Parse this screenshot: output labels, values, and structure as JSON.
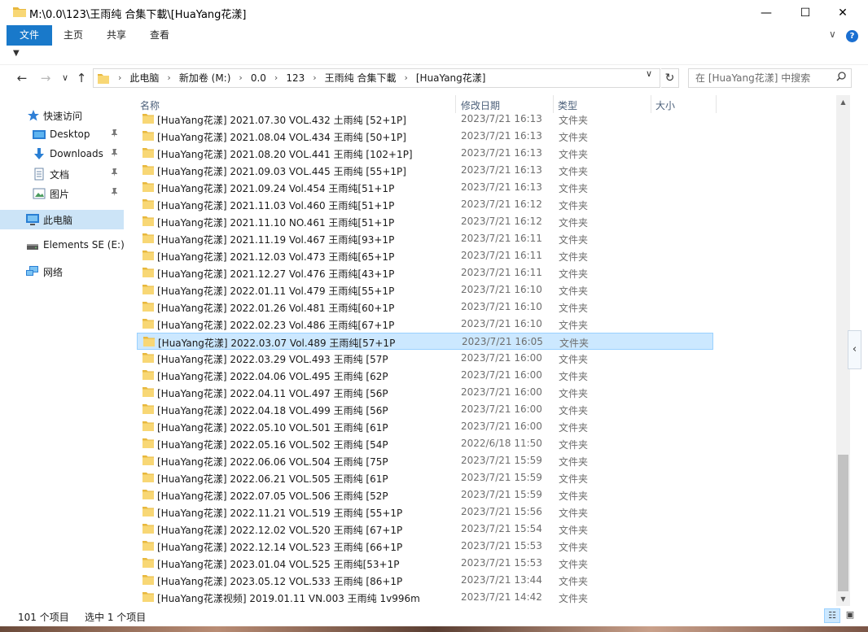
{
  "window": {
    "title": "M:\\0.0\\123\\王雨纯 合集下載\\[HuaYang花漾]",
    "minimize_glyph": "—",
    "maximize_glyph": "☐",
    "close_glyph": "✕"
  },
  "ribbon": {
    "tabs": [
      "文件",
      "主页",
      "共享",
      "查看"
    ],
    "expand_glyph": "∨",
    "help_glyph": "?"
  },
  "qat": {
    "glyph": "▼"
  },
  "nav": {
    "back_glyph": "←",
    "forward_glyph": "→",
    "history_glyph": "∨",
    "up_glyph": "↑",
    "refresh_glyph": "↻",
    "breadcrumb": [
      "此电脑",
      "新加卷 (M:)",
      "0.0",
      "123",
      "王雨纯 合集下載",
      "[HuaYang花漾]"
    ],
    "sep_glyph": "›",
    "dropdown_glyph": "∨"
  },
  "search": {
    "placeholder": "在 [HuaYang花漾] 中搜索"
  },
  "sidebar": {
    "quick_access": "快速访问",
    "items": [
      {
        "label": "Desktop",
        "icon": "desktop-icon",
        "pinned": true
      },
      {
        "label": "Downloads",
        "icon": "downloads-icon",
        "pinned": true
      },
      {
        "label": "文档",
        "icon": "documents-icon",
        "pinned": true
      },
      {
        "label": "图片",
        "icon": "pictures-icon",
        "pinned": true
      }
    ],
    "this_pc": "此电脑",
    "drive": "Elements SE (E:)",
    "network": "网络",
    "pin_glyph": "📌"
  },
  "columns": {
    "name": "名称",
    "date": "修改日期",
    "type": "类型",
    "size": "大小",
    "sort_glyph": "^"
  },
  "files": [
    {
      "name": "[HuaYang花漾] 2021.07.30 VOL.432 土雨纯 [52+1P]",
      "date": "2023/7/21 16:13",
      "type": "文件夹"
    },
    {
      "name": "[HuaYang花漾] 2021.08.04 VOL.434 王雨纯 [50+1P]",
      "date": "2023/7/21 16:13",
      "type": "文件夹"
    },
    {
      "name": "[HuaYang花漾] 2021.08.20 VOL.441 王雨纯 [102+1P]",
      "date": "2023/7/21 16:13",
      "type": "文件夹"
    },
    {
      "name": "[HuaYang花漾] 2021.09.03 VOL.445 王雨纯 [55+1P]",
      "date": "2023/7/21 16:13",
      "type": "文件夹"
    },
    {
      "name": "[HuaYang花漾] 2021.09.24 Vol.454 王雨纯[51+1P",
      "date": "2023/7/21 16:13",
      "type": "文件夹"
    },
    {
      "name": "[HuaYang花漾] 2021.11.03 Vol.460 王雨纯[51+1P",
      "date": "2023/7/21 16:12",
      "type": "文件夹"
    },
    {
      "name": "[HuaYang花漾] 2021.11.10 NO.461 王雨纯[51+1P",
      "date": "2023/7/21 16:12",
      "type": "文件夹"
    },
    {
      "name": "[HuaYang花漾] 2021.11.19 Vol.467 王雨纯[93+1P",
      "date": "2023/7/21 16:11",
      "type": "文件夹"
    },
    {
      "name": "[HuaYang花漾] 2021.12.03 Vol.473 王雨纯[65+1P",
      "date": "2023/7/21 16:11",
      "type": "文件夹"
    },
    {
      "name": "[HuaYang花漾] 2021.12.27 Vol.476 王雨纯[43+1P",
      "date": "2023/7/21 16:11",
      "type": "文件夹"
    },
    {
      "name": "[HuaYang花漾] 2022.01.11 Vol.479 王雨纯[55+1P",
      "date": "2023/7/21 16:10",
      "type": "文件夹"
    },
    {
      "name": "[HuaYang花漾] 2022.01.26 Vol.481 王雨纯[60+1P",
      "date": "2023/7/21 16:10",
      "type": "文件夹"
    },
    {
      "name": "[HuaYang花漾] 2022.02.23 Vol.486 王雨纯[67+1P",
      "date": "2023/7/21 16:10",
      "type": "文件夹"
    },
    {
      "name": "[HuaYang花漾] 2022.03.07 Vol.489 王雨纯[57+1P",
      "date": "2023/7/21 16:05",
      "type": "文件夹",
      "selected": true
    },
    {
      "name": "[HuaYang花漾] 2022.03.29 VOL.493 王雨纯 [57P",
      "date": "2023/7/21 16:00",
      "type": "文件夹"
    },
    {
      "name": "[HuaYang花漾] 2022.04.06 VOL.495 王雨纯 [62P",
      "date": "2023/7/21 16:00",
      "type": "文件夹"
    },
    {
      "name": "[HuaYang花漾] 2022.04.11 VOL.497 王雨纯 [56P",
      "date": "2023/7/21 16:00",
      "type": "文件夹"
    },
    {
      "name": "[HuaYang花漾] 2022.04.18 VOL.499 王雨纯 [56P",
      "date": "2023/7/21 16:00",
      "type": "文件夹"
    },
    {
      "name": "[HuaYang花漾] 2022.05.10 VOL.501 王雨纯 [61P",
      "date": "2023/7/21 16:00",
      "type": "文件夹"
    },
    {
      "name": "[HuaYang花漾] 2022.05.16 VOL.502 王雨纯 [54P",
      "date": "2022/6/18 11:50",
      "type": "文件夹"
    },
    {
      "name": "[HuaYang花漾] 2022.06.06 VOL.504 王雨纯 [75P",
      "date": "2023/7/21 15:59",
      "type": "文件夹"
    },
    {
      "name": "[HuaYang花漾] 2022.06.21 VOL.505 王雨纯 [61P",
      "date": "2023/7/21 15:59",
      "type": "文件夹"
    },
    {
      "name": "[HuaYang花漾] 2022.07.05 VOL.506 王雨纯 [52P",
      "date": "2023/7/21 15:59",
      "type": "文件夹"
    },
    {
      "name": "[HuaYang花漾] 2022.11.21 VOL.519 王雨纯 [55+1P",
      "date": "2023/7/21 15:56",
      "type": "文件夹"
    },
    {
      "name": "[HuaYang花漾] 2022.12.02 VOL.520 王雨纯 [67+1P",
      "date": "2023/7/21 15:54",
      "type": "文件夹"
    },
    {
      "name": "[HuaYang花漾] 2022.12.14 VOL.523 王雨纯 [66+1P",
      "date": "2023/7/21 15:53",
      "type": "文件夹"
    },
    {
      "name": "[HuaYang花漾] 2023.01.04 VOL.525 王雨纯[53+1P",
      "date": "2023/7/21 15:53",
      "type": "文件夹"
    },
    {
      "name": "[HuaYang花漾] 2023.05.12 VOL.533 王雨纯 [86+1P",
      "date": "2023/7/21 13:44",
      "type": "文件夹"
    },
    {
      "name": "[HuaYang花漾视频] 2019.01.11 VN.003 王雨纯 1v996m",
      "date": "2023/7/21 14:42",
      "type": "文件夹"
    }
  ],
  "status": {
    "count": "101 个项目",
    "selected": "选中 1 个项目"
  },
  "colors": {
    "accent": "#1979ca",
    "selection": "#cce8ff",
    "folder": "#f8d775"
  }
}
